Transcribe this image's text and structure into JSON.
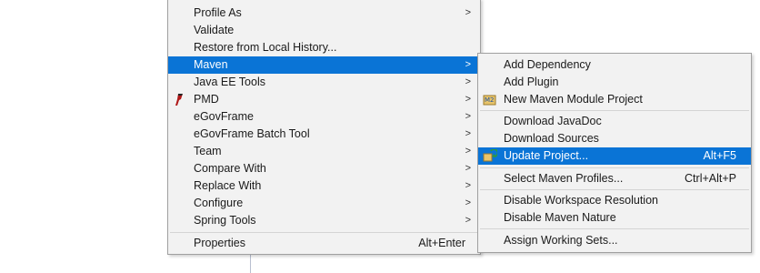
{
  "main_menu": {
    "items": [
      {
        "label": "Profile As",
        "has_submenu": true
      },
      {
        "label": "Validate",
        "has_submenu": false
      },
      {
        "label": "Restore from Local History...",
        "has_submenu": false
      },
      {
        "label": "Maven",
        "has_submenu": true,
        "selected": true
      },
      {
        "label": "Java EE Tools",
        "has_submenu": true
      },
      {
        "label": "PMD",
        "has_submenu": true,
        "icon": "pmd-icon"
      },
      {
        "label": "eGovFrame",
        "has_submenu": true
      },
      {
        "label": "eGovFrame Batch Tool",
        "has_submenu": true
      },
      {
        "label": "Team",
        "has_submenu": true
      },
      {
        "label": "Compare With",
        "has_submenu": true
      },
      {
        "label": "Replace With",
        "has_submenu": true
      },
      {
        "label": "Configure",
        "has_submenu": true
      },
      {
        "label": "Spring Tools",
        "has_submenu": true
      },
      {
        "label": "Properties",
        "shortcut": "Alt+Enter"
      }
    ],
    "arrow_glyph": ">"
  },
  "maven_submenu": {
    "items": [
      {
        "label": "Add Dependency"
      },
      {
        "label": "Add Plugin"
      },
      {
        "label": "New Maven Module Project",
        "icon": "maven-module-icon"
      },
      {
        "label": "Download JavaDoc"
      },
      {
        "label": "Download Sources"
      },
      {
        "label": "Update Project...",
        "shortcut": "Alt+F5",
        "icon": "update-project-icon",
        "selected": true
      },
      {
        "label": "Select Maven Profiles...",
        "shortcut": "Ctrl+Alt+P"
      },
      {
        "label": "Disable Workspace Resolution"
      },
      {
        "label": "Disable Maven Nature"
      },
      {
        "label": "Assign Working Sets..."
      }
    ]
  },
  "colors": {
    "menu_bg": "#f2f2f2",
    "selection": "#0a74d6",
    "separator": "#d4d4d4"
  }
}
